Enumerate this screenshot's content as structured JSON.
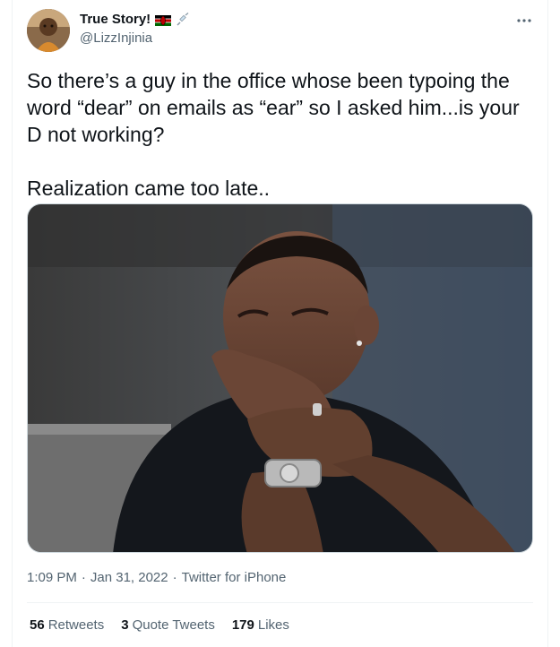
{
  "author": {
    "display_name": "True Story!",
    "handle": "@LizzInjinia",
    "badges": [
      "kenya-flag-icon",
      "syringe-icon"
    ]
  },
  "tweet": {
    "text": "So there’s a guy in the office whose been typoing the word “dear” on emails as “ear” so I asked him...is your D not working?\n\nRealization came too late.."
  },
  "media": {
    "description_icon": "photo-man-laughing"
  },
  "meta": {
    "time": "1:09 PM",
    "date": "Jan 31, 2022",
    "separator": "·",
    "source": "Twitter for iPhone"
  },
  "stats": {
    "retweets_count": "56",
    "retweets_label": "Retweets",
    "quote_count": "3",
    "quote_label": "Quote Tweets",
    "likes_count": "179",
    "likes_label": "Likes"
  },
  "colors": {
    "text_primary": "#0f1419",
    "text_secondary": "#536471",
    "border": "#eff3f4"
  }
}
